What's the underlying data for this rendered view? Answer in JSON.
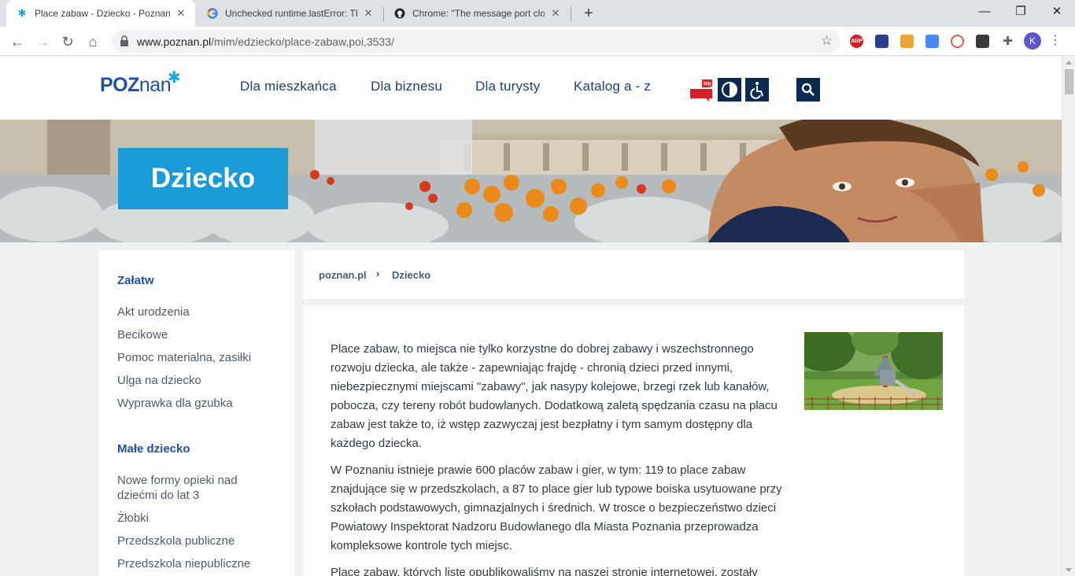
{
  "browser": {
    "tabs": [
      {
        "title": "Place zabaw - Dziecko - Poznan.p",
        "icon": "poznan-star-icon"
      },
      {
        "title": "Unchecked runtime.lastError: The",
        "icon": "google-icon"
      },
      {
        "title": "Chrome: \"The message port close",
        "icon": "github-icon"
      }
    ],
    "url": {
      "host": "www.poznan.pl",
      "path": "/mim/edziecko/place-zabaw,poi,3533/"
    },
    "extensions": [
      "ABP"
    ],
    "avatar_letter": "K"
  },
  "site": {
    "logo": {
      "upper": "POZ",
      "lower": "nan"
    },
    "nav": [
      "Dla mieszkańca",
      "Dla biznesu",
      "Dla turysty",
      "Katalog a - z"
    ],
    "bip_label": "bip",
    "banner_title": "Dziecko"
  },
  "sidebar": {
    "sections": [
      {
        "heading": "Załatw",
        "items": [
          "Akt urodzenia",
          "Becikowe",
          "Pomoc materialna, zasiłki",
          "Ulga na dziecko",
          "Wyprawka dla gzubka"
        ]
      },
      {
        "heading": "Małe dziecko",
        "items": [
          "Nowe formy opieki nad dziećmi do lat 3",
          "Żłobki",
          "Przedszkola publiczne",
          "Przedszkola niepubliczne"
        ]
      }
    ]
  },
  "breadcrumb": [
    "poznan.pl",
    "Dziecko"
  ],
  "article": {
    "paragraphs": [
      "Place zabaw, to miejsca nie tylko korzystne do dobrej zabawy i wszechstronnego rozwoju dziecka, ale także - zapewniając frajdę - chronią dzieci przed innymi, niebezpiecznymi miejscami \"zabawy\", jak nasypy kolejowe, brzegi rzek lub kanałów, pobocza, czy tereny robót budowlanych. Dodatkową zaletą spędzania czasu na placu zabaw jest także to, iż wstęp zazwyczaj jest bezpłatny i tym samym dostępny dla każdego dziecka.",
      "W Poznaniu istnieje prawie 600 placów zabaw i gier, w tym: 119 to place zabaw znajdujące się w przedszkolach, a 87 to place gier lub typowe boiska usytuowane przy szkołach podstawowych, gimnazjalnych i średnich. W trosce o bezpieczeństwo dzieci Powiatowy Inspektorat Nadzoru Budowlanego dla Miasta Poznania przeprowadza kompleksowe kontrole tych miejsc.",
      "Place zabaw, których listę opublikowaliśmy na naszej stronie internetowej, zostały"
    ]
  },
  "colors": {
    "brand_blue": "#1f4f9e",
    "banner_accent": "#1a9ad7",
    "dark_button": "#0b2a52"
  }
}
